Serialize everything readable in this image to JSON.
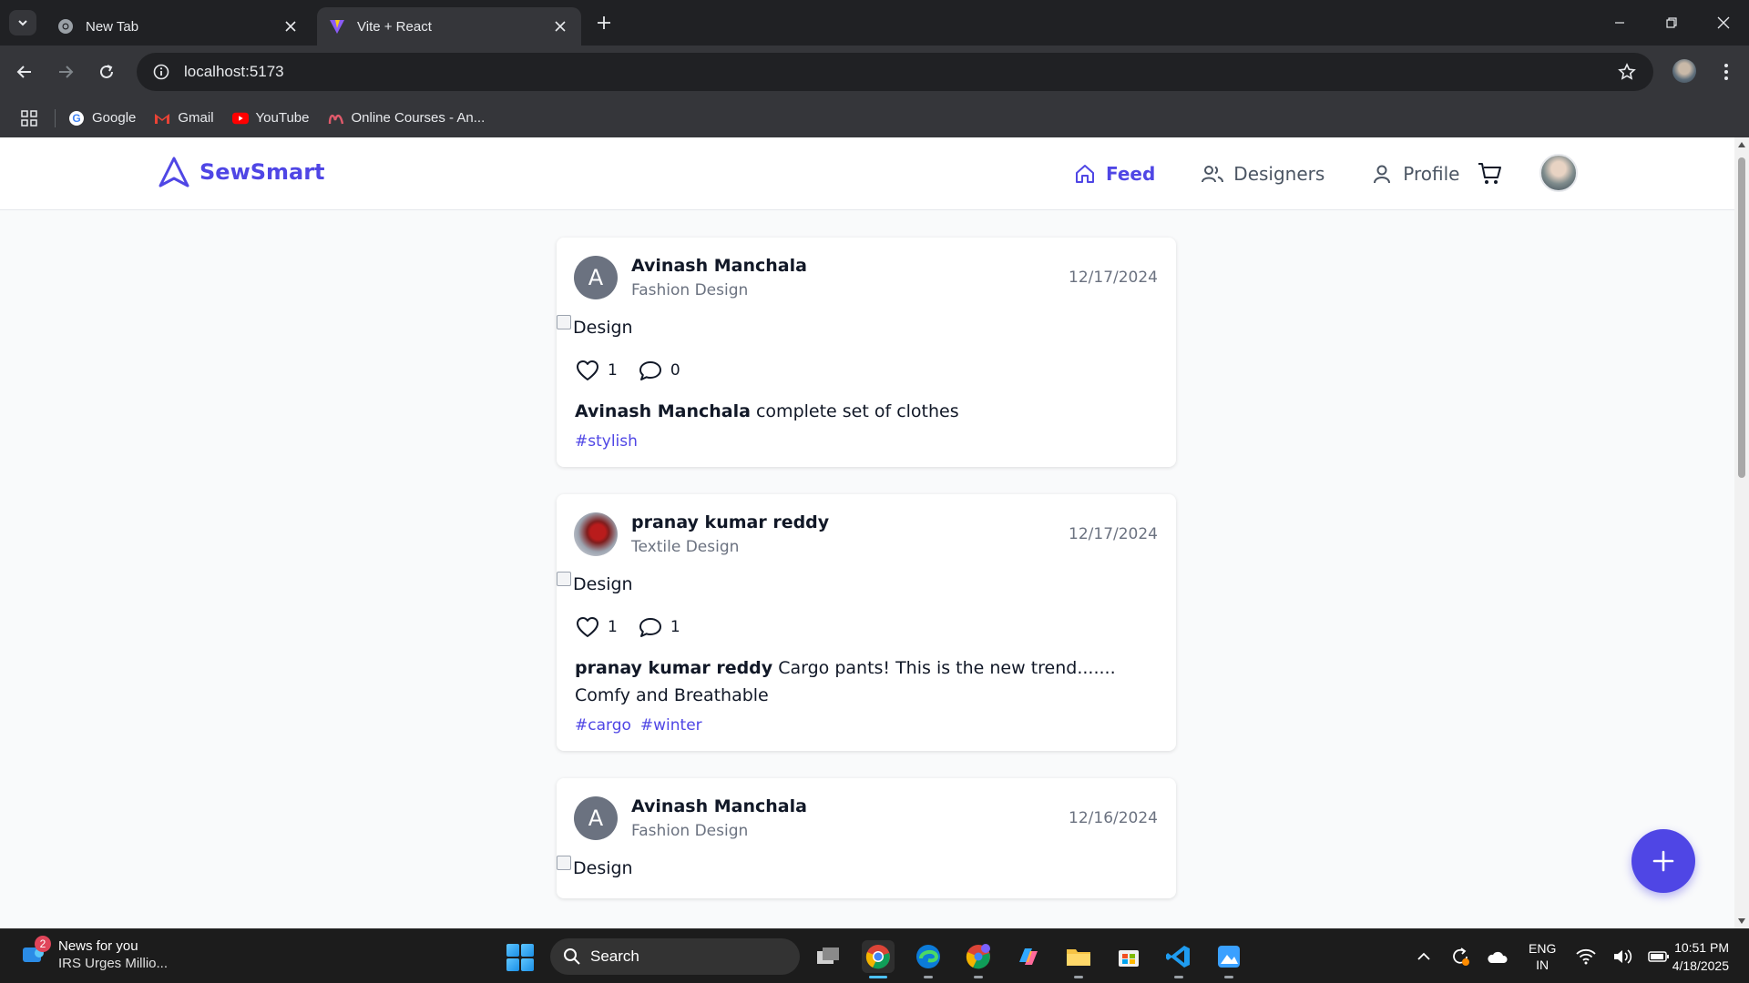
{
  "browser": {
    "tabs": [
      {
        "title": "New Tab",
        "active": false,
        "icon": "chrome-icon"
      },
      {
        "title": "Vite + React",
        "active": true,
        "icon": "vite-icon"
      }
    ],
    "url": "localhost:5173",
    "bookmarks": [
      {
        "label": "Google",
        "icon": "google-icon"
      },
      {
        "label": "Gmail",
        "icon": "gmail-icon"
      },
      {
        "label": "YouTube",
        "icon": "youtube-icon"
      },
      {
        "label": "Online Courses - An...",
        "icon": "udemy-icon"
      }
    ]
  },
  "app": {
    "brand": "SewSmart",
    "accent_color": "#4f46e5",
    "nav": [
      {
        "label": "Feed",
        "icon": "home-icon",
        "active": true
      },
      {
        "label": "Designers",
        "icon": "users-icon",
        "active": false
      },
      {
        "label": "Profile",
        "icon": "user-icon",
        "active": false
      }
    ]
  },
  "posts": [
    {
      "author": "Avinash Manchala",
      "initial": "A",
      "role": "Fashion Design",
      "date": "12/17/2024",
      "image_alt": "Design",
      "likes": "1",
      "comments": "0",
      "caption": "complete set of clothes",
      "tags": [
        "#stylish"
      ]
    },
    {
      "author": "pranay kumar reddy",
      "initial": "",
      "role": "Textile Design",
      "date": "12/17/2024",
      "image_alt": "Design",
      "likes": "1",
      "comments": "1",
      "caption": "Cargo pants! This is the new trend....... Comfy and Breathable",
      "tags": [
        "#cargo",
        "#winter"
      ]
    },
    {
      "author": "Avinash Manchala",
      "initial": "A",
      "role": "Fashion Design",
      "date": "12/16/2024",
      "image_alt": "Design",
      "likes": "",
      "comments": "",
      "caption": "",
      "tags": []
    }
  ],
  "taskbar": {
    "news_title": "News for you",
    "news_sub": "IRS Urges Millio...",
    "news_badge": "2",
    "search_label": "Search",
    "lang_top": "ENG",
    "lang_bottom": "IN",
    "time": "10:51 PM",
    "date": "4/18/2025"
  }
}
